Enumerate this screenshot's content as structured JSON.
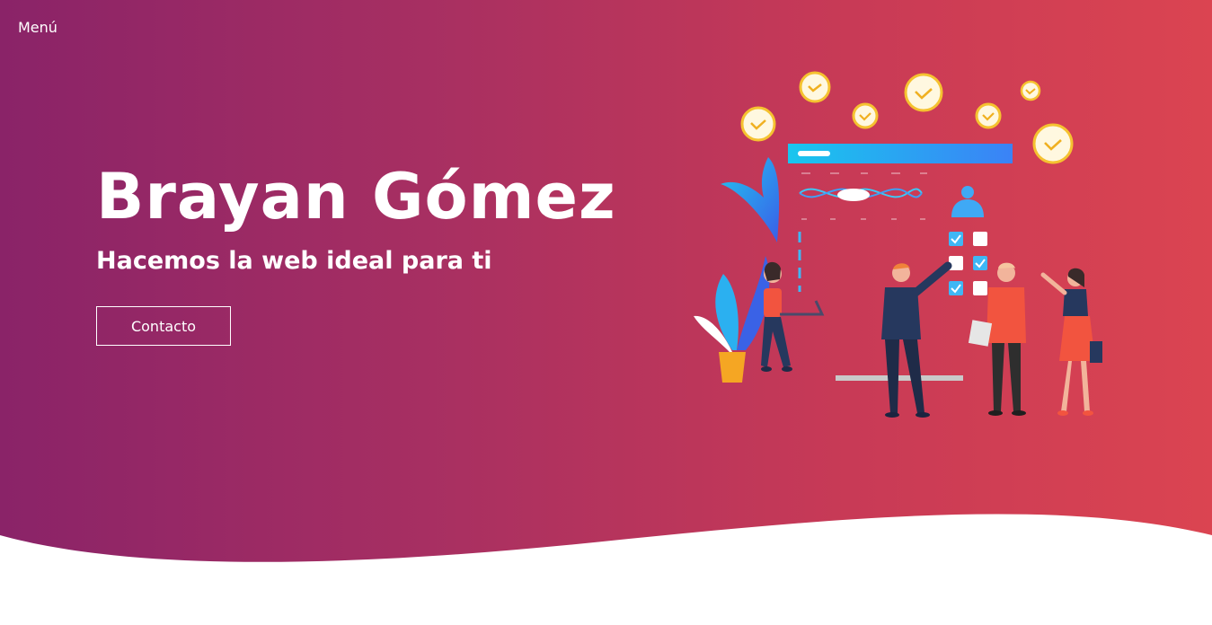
{
  "nav": {
    "menu_label": "Menú"
  },
  "hero": {
    "title": "Brayan Gómez",
    "subtitle": "Hacemos la web ideal para ti",
    "contact_label": "Contacto"
  },
  "colors": {
    "gradient_start": "#8a2368",
    "gradient_end": "#db4451",
    "text": "#ffffff",
    "background": "#ffffff"
  }
}
